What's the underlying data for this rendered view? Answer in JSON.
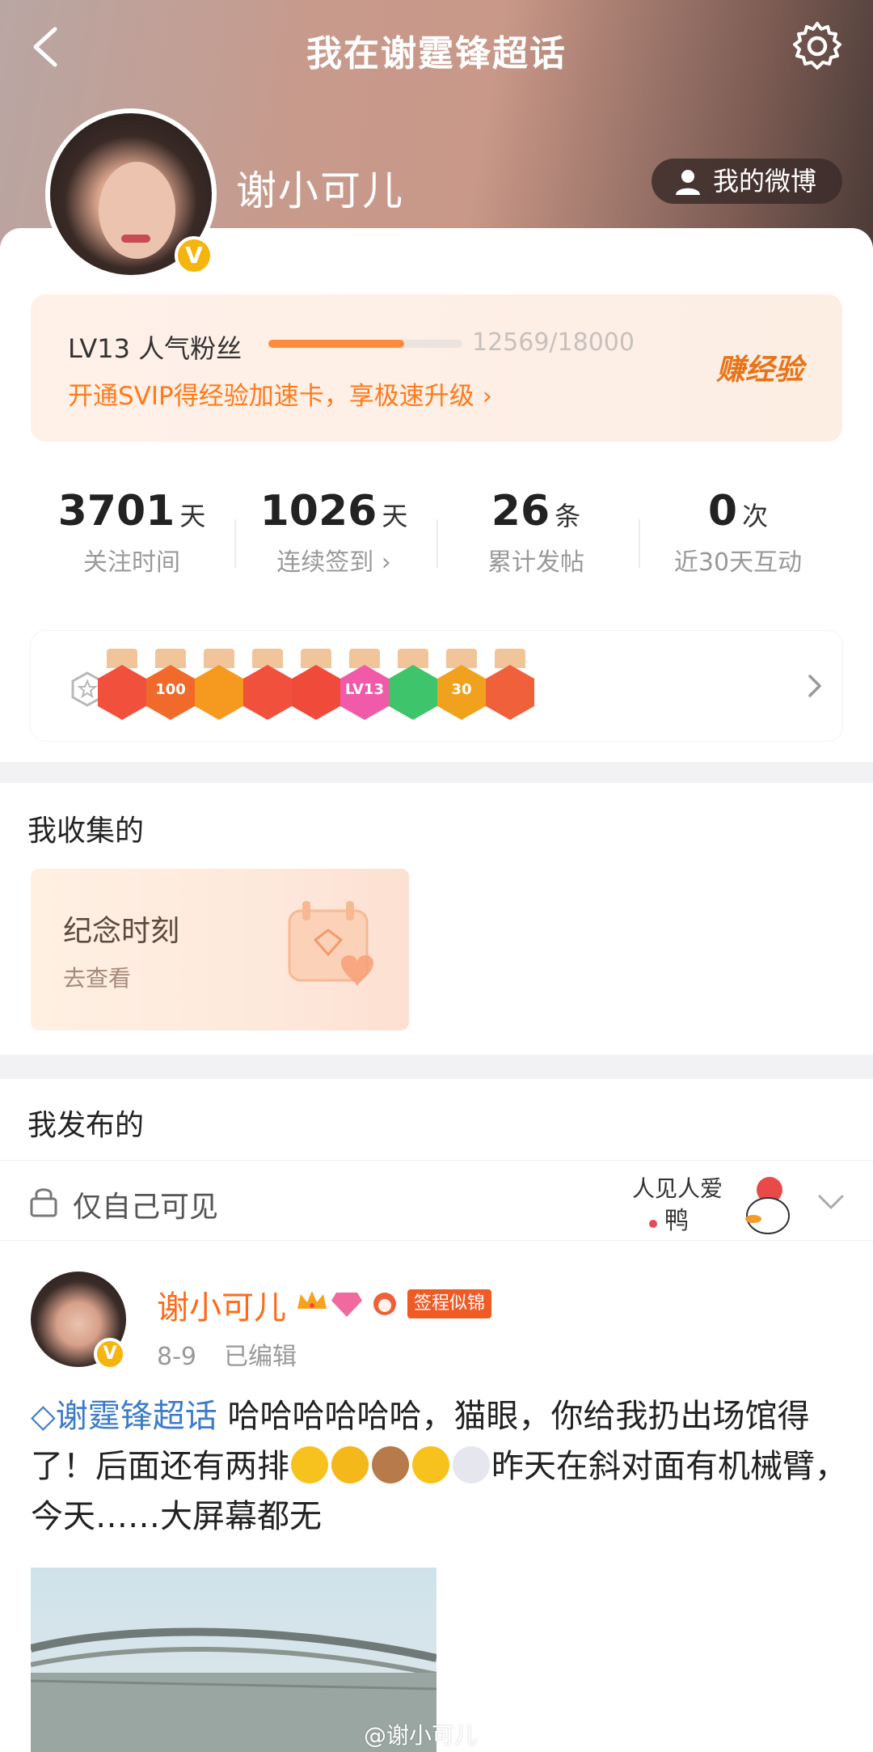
{
  "header": {
    "title": "我在谢霆锋超话",
    "username": "谢小可儿",
    "my_weibo_label": "我的微博",
    "verified_badge": "V"
  },
  "level": {
    "label": "LV13 人气粉丝",
    "exp_text": "12569/18000",
    "progress": 0.698,
    "promo_text": "开通SVIP得经验加速卡，享极速升级",
    "earn_label": "赚经验"
  },
  "stats": [
    {
      "value": "3701",
      "unit": "天",
      "label": "关注时间"
    },
    {
      "value": "1026",
      "unit": "天",
      "label": "连续签到"
    },
    {
      "value": "26",
      "unit": "条",
      "label": "累计发帖"
    },
    {
      "value": "0",
      "unit": "次",
      "label": "近30天互动"
    }
  ],
  "badges": [
    {
      "name": "rabbit-badge",
      "text": "",
      "color": "#f0503c"
    },
    {
      "name": "100-days-badge",
      "text": "100",
      "color": "#f06a2c"
    },
    {
      "name": "crown-badge",
      "text": "",
      "color": "#f59a1e"
    },
    {
      "name": "girl-badge",
      "text": "",
      "color": "#f0503c"
    },
    {
      "name": "phoenix-badge",
      "text": "",
      "color": "#f04a3a"
    },
    {
      "name": "lv13-badge",
      "text": "LV13",
      "color": "#f05aa8"
    },
    {
      "name": "hand-badge",
      "text": "",
      "color": "#3ec46a"
    },
    {
      "name": "30-days-badge",
      "text": "30",
      "color": "#f0a21e"
    },
    {
      "name": "rock-hand-badge",
      "text": "",
      "color": "#f0603a"
    }
  ],
  "collect": {
    "title": "我收集的",
    "card_title": "纪念时刻",
    "card_sub": "去查看"
  },
  "posts_section": {
    "title": "我发布的",
    "visibility": "仅自己可见",
    "sticker_text_line1": "人见人爱",
    "sticker_text_line2": "鸭"
  },
  "post": {
    "author": "谢小可儿",
    "tag": "签程似锦",
    "date": "8-9",
    "edited": "已编辑",
    "topic": "谢霆锋超话",
    "text1": "哈哈哈哈哈哈，猫眼，你给我扔出场馆得了！后面还有两排",
    "text2": "昨天在斜对面有机械臂，今天……大屏幕都无",
    "watermark": "@谢小可儿"
  },
  "colors": {
    "accent_orange": "#ff7a1a",
    "topic_blue": "#3d7cc9",
    "verified_gold": "#f5b40e"
  }
}
